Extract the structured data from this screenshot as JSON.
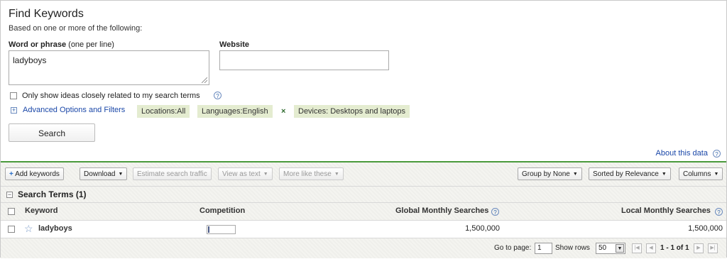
{
  "header": {
    "title": "Find Keywords",
    "subtitle": "Based on one or more of the following:"
  },
  "form": {
    "word_label": "Word or phrase",
    "word_hint": "(one per line)",
    "word_value": "ladyboys",
    "website_label": "Website",
    "website_value": "",
    "closely_related_label": "Only show ideas closely related to my search terms",
    "advanced_label": "Advanced Options and Filters",
    "chips": {
      "locations": "Locations:All",
      "languages": "Languages:English",
      "devices": "Devices: Desktops and laptops",
      "remove": "×"
    },
    "search_button": "Search"
  },
  "about_link": "About this data",
  "toolbar": {
    "add_keywords": "Add keywords",
    "download": "Download",
    "estimate_traffic": "Estimate search traffic",
    "view_as_text": "View as text",
    "more_like_these": "More like these",
    "group_by": "Group by None",
    "sorted_by": "Sorted by Relevance",
    "columns": "Columns"
  },
  "section": {
    "title": "Search Terms (1)"
  },
  "table": {
    "headers": {
      "keyword": "Keyword",
      "competition": "Competition",
      "global": "Global Monthly Searches",
      "local": "Local Monthly Searches"
    },
    "rows": [
      {
        "keyword": "ladyboys",
        "competition": 0.04,
        "global": "1,500,000",
        "local": "1,500,000"
      }
    ]
  },
  "pager": {
    "goto_label": "Go to page:",
    "goto_value": "1",
    "show_rows_label": "Show rows",
    "rows_value": "50",
    "range": "1 - 1 of 1"
  },
  "colors": {
    "link": "#1a47a8",
    "accent_green": "#4a9a3c",
    "chip_bg": "#e4ecd0"
  }
}
